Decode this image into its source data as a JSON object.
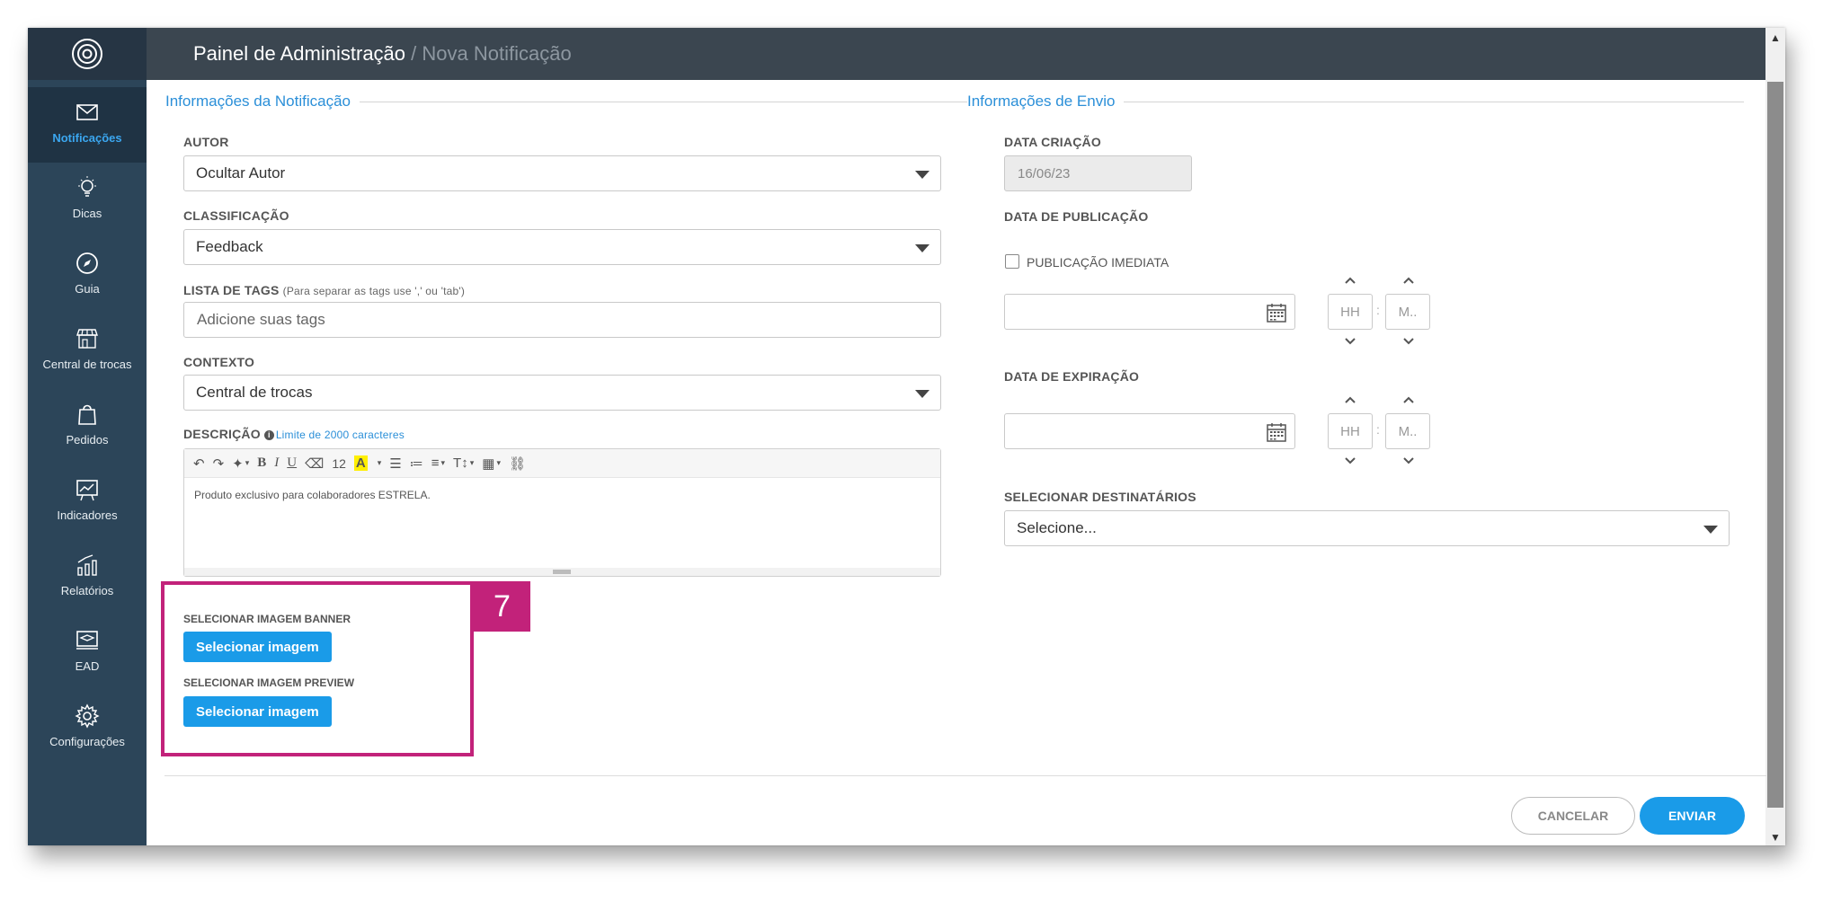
{
  "header": {
    "section": "Painel de Administração",
    "separator": " / ",
    "page": "Nova Notificação"
  },
  "sidebar": {
    "items": [
      {
        "label": "Notificações",
        "icon": "mail-icon",
        "active": true
      },
      {
        "label": "Dicas",
        "icon": "lightbulb-icon"
      },
      {
        "label": "Guia",
        "icon": "compass-icon"
      },
      {
        "label": "Central de trocas",
        "icon": "store-icon"
      },
      {
        "label": "Pedidos",
        "icon": "shopping-bag-icon"
      },
      {
        "label": "Indicadores",
        "icon": "chart-board-icon"
      },
      {
        "label": "Relatórios",
        "icon": "bar-chart-icon"
      },
      {
        "label": "EAD",
        "icon": "graduation-laptop-icon"
      },
      {
        "label": "Configurações",
        "icon": "gear-icon"
      }
    ]
  },
  "notification_info": {
    "title": "Informações da Notificação",
    "author": {
      "label": "AUTOR",
      "value": "Ocultar Autor"
    },
    "classification": {
      "label": "CLASSIFICAÇÃO",
      "value": "Feedback"
    },
    "tags": {
      "label": "LISTA DE TAGS",
      "hint": "(Para separar as tags use ',' ou 'tab')",
      "placeholder": "Adicione suas tags"
    },
    "context": {
      "label": "CONTEXTO",
      "value": "Central de trocas"
    },
    "description": {
      "label": "DESCRIÇÃO",
      "limit": "Limite de 2000 caracteres",
      "font_size": "12",
      "text": "Produto exclusivo para colaboradores ESTRELA."
    },
    "banner_image": {
      "label": "SELECIONAR IMAGEM BANNER",
      "button": "Selecionar imagem"
    },
    "preview_image": {
      "label": "SELECIONAR IMAGEM PREVIEW",
      "button": "Selecionar imagem"
    }
  },
  "step_badge": "7",
  "send_info": {
    "title": "Informações de Envio",
    "creation_date": {
      "label": "DATA CRIAÇÃO",
      "value": "16/06/23"
    },
    "publication_date": {
      "label": "DATA DE PUBLICAÇÃO",
      "immediate_label": "PUBLICAÇÃO IMEDIATA",
      "hour_placeholder": "HH",
      "minute_placeholder": "M..",
      "separator": ":"
    },
    "expiration_date": {
      "label": "DATA DE EXPIRAÇÃO",
      "hour_placeholder": "HH",
      "minute_placeholder": "M..",
      "separator": ":"
    },
    "recipients": {
      "label": "SELECIONAR DESTINATÁRIOS",
      "value": "Selecione..."
    }
  },
  "actions": {
    "cancel": "CANCELAR",
    "send": "ENVIAR"
  },
  "colors": {
    "accent": "#1a9be8",
    "sidebar": "#2c4559",
    "highlight": "#c2227a",
    "header": "#3b4650"
  }
}
